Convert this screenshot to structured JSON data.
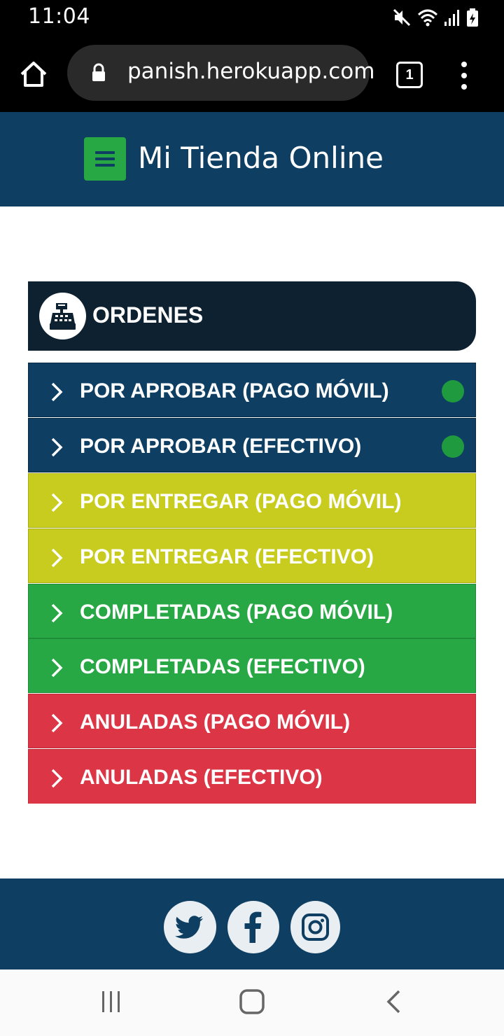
{
  "status_bar": {
    "time": "11:04"
  },
  "browser": {
    "url": "panish.herokuapp.com",
    "tab_count": "1"
  },
  "header": {
    "brand": "Mi Tienda Online"
  },
  "orders": {
    "title": "ORDENES",
    "items": [
      {
        "label": "POR APROBAR (PAGO MÓVIL)",
        "color": "#0e3f63",
        "indicator": true
      },
      {
        "label": "POR APROBAR (EFECTIVO)",
        "color": "#0e3f63",
        "indicator": true
      },
      {
        "label": "POR ENTREGAR (PAGO MÓVIL)",
        "color": "#c8cc1e",
        "indicator": false
      },
      {
        "label": "POR ENTREGAR (EFECTIVO)",
        "color": "#c8cc1e",
        "indicator": false
      },
      {
        "label": "COMPLETADAS (PAGO MÓVIL)",
        "color": "#28a745",
        "indicator": false
      },
      {
        "label": "COMPLETADAS (EFECTIVO)",
        "color": "#28a745",
        "indicator": false
      },
      {
        "label": "ANULADAS (PAGO MÓVIL)",
        "color": "#dc3545",
        "indicator": false
      },
      {
        "label": "ANULADAS (EFECTIVO)",
        "color": "#dc3545",
        "indicator": false
      }
    ]
  },
  "footer": {
    "social": [
      "twitter-icon",
      "facebook-icon",
      "instagram-icon"
    ]
  },
  "colors": {
    "primary": "#0e3f63",
    "dark": "#0d2131",
    "success": "#28a745",
    "warning": "#c8cc1e",
    "danger": "#dc3545"
  }
}
